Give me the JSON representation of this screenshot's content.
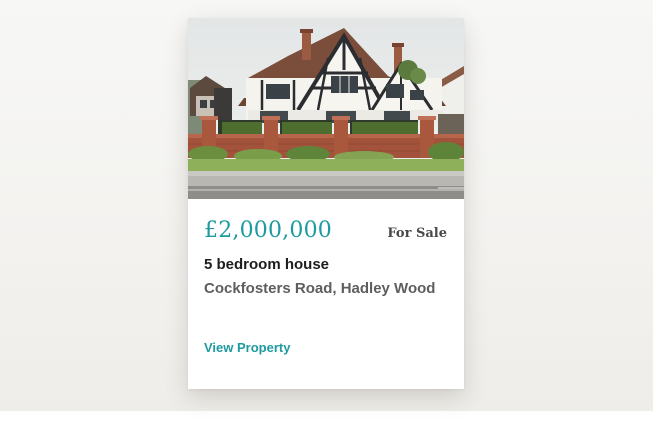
{
  "listing": {
    "price": "£2,000,000",
    "status": "For Sale",
    "title": "5 bedroom house",
    "address": "Cockfosters Road, Hadley Wood",
    "cta_label": "View Property",
    "accent_color": "#1e9aa0"
  }
}
